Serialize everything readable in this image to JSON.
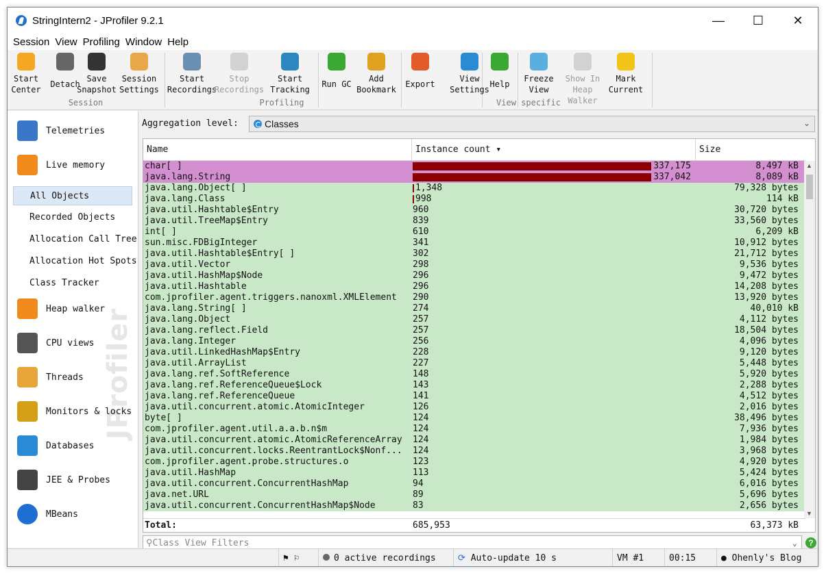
{
  "window": {
    "title": "StringIntern2 - JProfiler 9.2.1"
  },
  "menu": [
    "Session",
    "View",
    "Profiling",
    "Window",
    "Help"
  ],
  "ribbon": {
    "buttons": [
      {
        "l1": "Start",
        "l2": "Center",
        "icon": "start-center-icon"
      },
      {
        "l1": "",
        "l2": "Detach",
        "icon": "detach-icon"
      },
      {
        "l1": "Save",
        "l2": "Snapshot",
        "icon": "save-snapshot-icon"
      },
      {
        "l1": "Session",
        "l2": "Settings",
        "icon": "session-settings-icon"
      },
      {
        "l1": "Start",
        "l2": "Recordings",
        "icon": "start-recordings-icon"
      },
      {
        "l1": "Stop",
        "l2": "Recordings",
        "icon": "stop-recordings-icon"
      },
      {
        "l1": "Start",
        "l2": "Tracking",
        "icon": "start-tracking-icon"
      },
      {
        "l1": "",
        "l2": "Run GC",
        "icon": "run-gc-icon"
      },
      {
        "l1": "Add",
        "l2": "Bookmark",
        "icon": "add-bookmark-icon"
      },
      {
        "l1": "",
        "l2": "Export",
        "icon": "export-icon"
      },
      {
        "l1": "View",
        "l2": "Settings",
        "icon": "view-settings-icon"
      },
      {
        "l1": "",
        "l2": "Help",
        "icon": "help-icon"
      },
      {
        "l1": "Freeze",
        "l2": "View",
        "icon": "freeze-view-icon"
      },
      {
        "l1": "Show In",
        "l2": "Heap Walker",
        "icon": "show-in-heap-walker-icon"
      },
      {
        "l1": "Mark",
        "l2": "Current",
        "icon": "mark-current-icon"
      }
    ],
    "groups": [
      "Session",
      "Profiling",
      "View specific"
    ]
  },
  "sidebar": {
    "sections": [
      "Telemetries",
      "Live memory",
      "Heap walker",
      "CPU views",
      "Threads",
      "Monitors & locks",
      "Databases",
      "JEE & Probes",
      "MBeans"
    ],
    "live_memory_items": [
      "All Objects",
      "Recorded Objects",
      "Allocation Call Tree",
      "Allocation Hot Spots",
      "Class Tracker"
    ],
    "watermark": "JProfiler"
  },
  "aggregation": {
    "label": "Aggregation level:",
    "value": "Classes"
  },
  "table": {
    "columns": [
      "Name",
      "Instance count",
      "Size"
    ],
    "rows": [
      {
        "name": "char[ ]",
        "count": "337,175",
        "size": "8,497 kB",
        "frac": 1.0
      },
      {
        "name": "java.lang.String",
        "count": "337,042",
        "size": "8,089 kB",
        "frac": 0.9996
      },
      {
        "name": "java.lang.Object[ ]",
        "count": "1,348",
        "size": "79,328 bytes",
        "frac": 0.004
      },
      {
        "name": "java.lang.Class",
        "count": "998",
        "size": "114 kB",
        "frac": 0.003
      },
      {
        "name": "java.util.Hashtable$Entry",
        "count": "960",
        "size": "30,720 bytes",
        "frac": 0
      },
      {
        "name": "java.util.TreeMap$Entry",
        "count": "839",
        "size": "33,560 bytes",
        "frac": 0
      },
      {
        "name": "int[ ]",
        "count": "610",
        "size": "6,209 kB",
        "frac": 0
      },
      {
        "name": "sun.misc.FDBigInteger",
        "count": "341",
        "size": "10,912 bytes",
        "frac": 0
      },
      {
        "name": "java.util.Hashtable$Entry[ ]",
        "count": "302",
        "size": "21,712 bytes",
        "frac": 0
      },
      {
        "name": "java.util.Vector",
        "count": "298",
        "size": "9,536 bytes",
        "frac": 0
      },
      {
        "name": "java.util.HashMap$Node",
        "count": "296",
        "size": "9,472 bytes",
        "frac": 0
      },
      {
        "name": "java.util.Hashtable",
        "count": "296",
        "size": "14,208 bytes",
        "frac": 0
      },
      {
        "name": "com.jprofiler.agent.triggers.nanoxml.XMLElement",
        "count": "290",
        "size": "13,920 bytes",
        "frac": 0
      },
      {
        "name": "java.lang.String[ ]",
        "count": "274",
        "size": "40,010 kB",
        "frac": 0
      },
      {
        "name": "java.lang.Object",
        "count": "257",
        "size": "4,112 bytes",
        "frac": 0
      },
      {
        "name": "java.lang.reflect.Field",
        "count": "257",
        "size": "18,504 bytes",
        "frac": 0
      },
      {
        "name": "java.lang.Integer",
        "count": "256",
        "size": "4,096 bytes",
        "frac": 0
      },
      {
        "name": "java.util.LinkedHashMap$Entry",
        "count": "228",
        "size": "9,120 bytes",
        "frac": 0
      },
      {
        "name": "java.util.ArrayList",
        "count": "227",
        "size": "5,448 bytes",
        "frac": 0
      },
      {
        "name": "java.lang.ref.SoftReference",
        "count": "148",
        "size": "5,920 bytes",
        "frac": 0
      },
      {
        "name": "java.lang.ref.ReferenceQueue$Lock",
        "count": "143",
        "size": "2,288 bytes",
        "frac": 0
      },
      {
        "name": "java.lang.ref.ReferenceQueue",
        "count": "141",
        "size": "4,512 bytes",
        "frac": 0
      },
      {
        "name": "java.util.concurrent.atomic.AtomicInteger",
        "count": "126",
        "size": "2,016 bytes",
        "frac": 0
      },
      {
        "name": "byte[ ]",
        "count": "124",
        "size": "38,496 bytes",
        "frac": 0
      },
      {
        "name": "com.jprofiler.agent.util.a.a.b.n$m",
        "count": "124",
        "size": "7,936 bytes",
        "frac": 0
      },
      {
        "name": "java.util.concurrent.atomic.AtomicReferenceArray",
        "count": "124",
        "size": "1,984 bytes",
        "frac": 0
      },
      {
        "name": "java.util.concurrent.locks.ReentrantLock$Nonf...",
        "count": "124",
        "size": "3,968 bytes",
        "frac": 0
      },
      {
        "name": "com.jprofiler.agent.probe.structures.o",
        "count": "123",
        "size": "4,920 bytes",
        "frac": 0
      },
      {
        "name": "java.util.HashMap",
        "count": "113",
        "size": "5,424 bytes",
        "frac": 0
      },
      {
        "name": "java.util.concurrent.ConcurrentHashMap",
        "count": "94",
        "size": "6,016 bytes",
        "frac": 0
      },
      {
        "name": "java.net.URL",
        "count": "89",
        "size": "5,696 bytes",
        "frac": 0
      },
      {
        "name": "java.util.concurrent.ConcurrentHashMap$Node",
        "count": "83",
        "size": "2,656 bytes",
        "frac": 0
      }
    ],
    "total": {
      "label": "Total:",
      "count": "685,953",
      "size": "63,373 kB"
    }
  },
  "filter": {
    "placeholder": "Class View Filters"
  },
  "status": {
    "recordings": "0 active recordings",
    "autoupdate": "Auto-update 10 s",
    "vm": "VM #1",
    "time": "00:15",
    "overlay": "Ohenly's Blog"
  },
  "colors": {
    "highlight_row": "#d48fd0",
    "normal_row": "#c8e8c8",
    "bar": "#8b0000"
  }
}
